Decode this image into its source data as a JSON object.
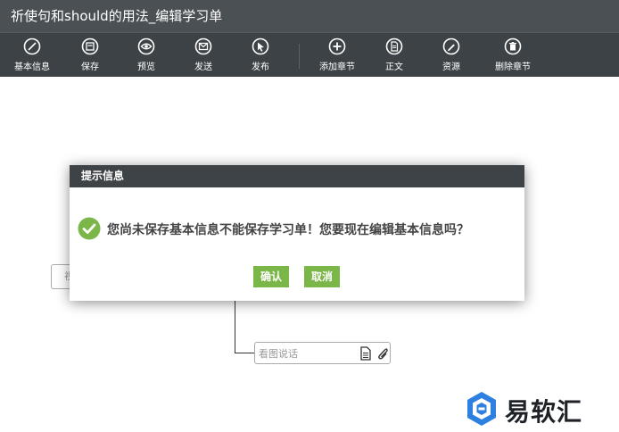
{
  "window": {
    "title": "祈使句和should的用法_编辑学习单"
  },
  "toolbar": {
    "items": [
      {
        "label": "基本信息",
        "icon": "edit-slash-icon"
      },
      {
        "label": "保存",
        "icon": "save-icon"
      },
      {
        "label": "预览",
        "icon": "eye-icon"
      },
      {
        "label": "发送",
        "icon": "envelope-icon"
      },
      {
        "label": "发布",
        "icon": "cursor-icon"
      },
      {
        "label": "添加章节",
        "icon": "plus-circle-icon"
      },
      {
        "label": "正文",
        "icon": "document-icon"
      },
      {
        "label": "资源",
        "icon": "pencil-icon"
      },
      {
        "label": "删除章节",
        "icon": "trash-icon"
      }
    ]
  },
  "canvas": {
    "partial_node_text": "视",
    "node_placeholder": "看图说话"
  },
  "dialog": {
    "title": "提示信息",
    "message": "您尚未保存基本信息不能保存学习单！您要现在编辑基本信息吗？",
    "confirm_label": "确认",
    "cancel_label": "取消"
  },
  "watermark": {
    "text": "易软汇"
  },
  "colors": {
    "titlebar": "#4a5054",
    "toolbar": "#3c4245",
    "dialog_header": "#3e4347",
    "button": "#7ab648",
    "check": "#7ab648",
    "watermark_blue": "#2d7fe0"
  }
}
